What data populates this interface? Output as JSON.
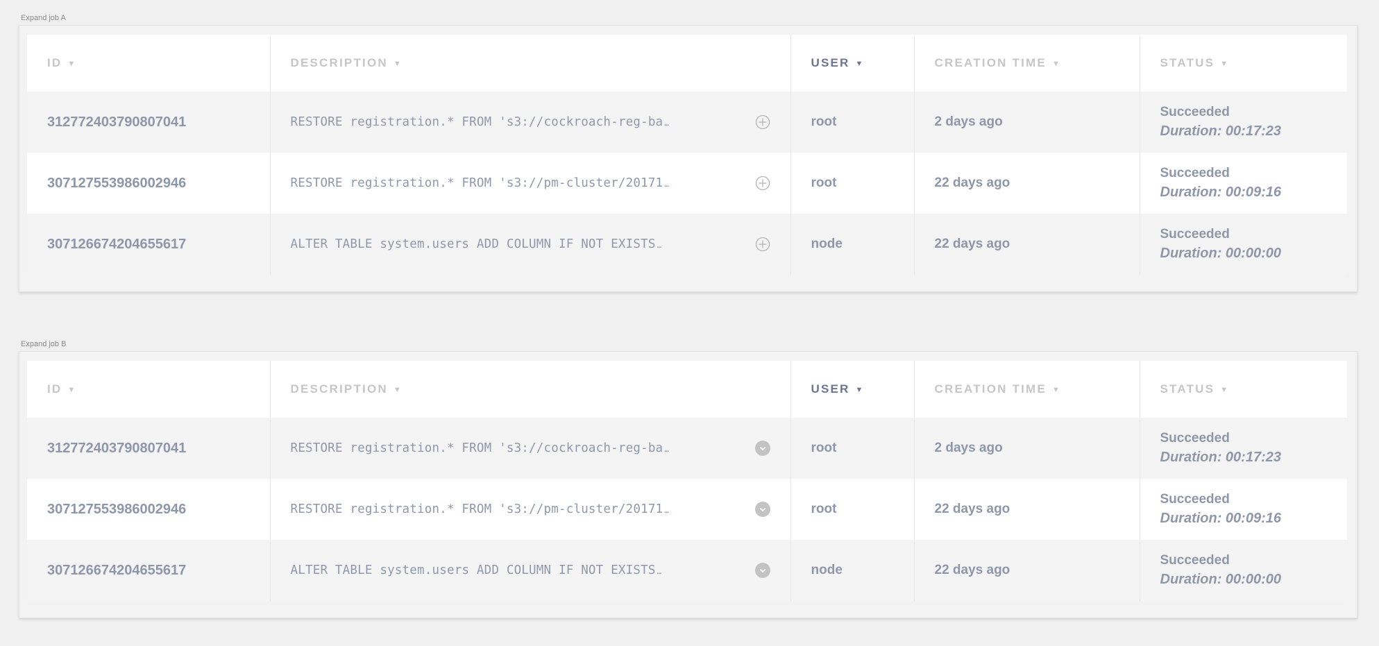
{
  "headers": {
    "id": "ID",
    "description": "DESCRIPTION",
    "user": "USER",
    "creation_time": "CREATION TIME",
    "status": "STATUS"
  },
  "panels": [
    {
      "label": "Expand job A",
      "expand_icon": "circle-plus-icon",
      "rows": [
        {
          "id": "312772403790807041",
          "description": "RESTORE registration.* FROM 's3://cockroach-reg-ba",
          "user": "root",
          "created": "2 days ago",
          "status": "Succeeded",
          "duration": "Duration: 00:17:23"
        },
        {
          "id": "307127553986002946",
          "description": "RESTORE registration.* FROM 's3://pm-cluster/20171",
          "user": "root",
          "created": "22 days ago",
          "status": "Succeeded",
          "duration": "Duration: 00:09:16"
        },
        {
          "id": "307126674204655617",
          "description": "ALTER TABLE system.users ADD COLUMN IF NOT EXISTS",
          "user": "node",
          "created": "22 days ago",
          "status": "Succeeded",
          "duration": "Duration: 00:00:00"
        }
      ]
    },
    {
      "label": "Expand job B",
      "expand_icon": "circle-chevron-down-icon",
      "rows": [
        {
          "id": "312772403790807041",
          "description": "RESTORE registration.* FROM 's3://cockroach-reg-ba",
          "user": "root",
          "created": "2 days ago",
          "status": "Succeeded",
          "duration": "Duration: 00:17:23"
        },
        {
          "id": "307127553986002946",
          "description": "RESTORE registration.* FROM 's3://pm-cluster/20171",
          "user": "root",
          "created": "22 days ago",
          "status": "Succeeded",
          "duration": "Duration: 00:09:16"
        },
        {
          "id": "307126674204655617",
          "description": "ALTER TABLE system.users ADD COLUMN IF NOT EXISTS",
          "user": "node",
          "created": "22 days ago",
          "status": "Succeeded",
          "duration": "Duration: 00:00:00"
        }
      ]
    }
  ],
  "colors": {
    "background": "#f0f0f0",
    "header_text": "#c6c6c6",
    "active_header_text": "#6b7592",
    "cell_text": "#8e97aa"
  }
}
